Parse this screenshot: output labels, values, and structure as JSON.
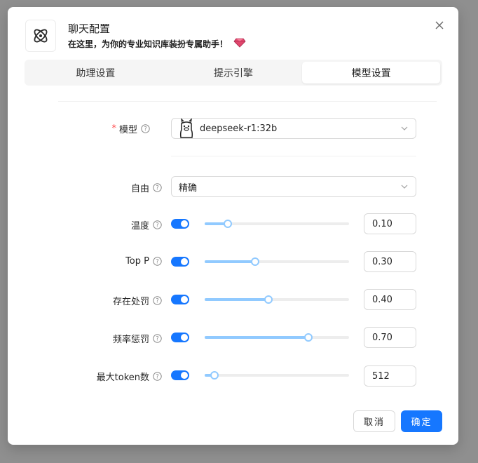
{
  "dialog": {
    "title": "聊天配置",
    "subtitle": "在这里，为你的专业知识库装扮专属助手！",
    "accent": "#1677ff"
  },
  "tabs": [
    {
      "label": "助理设置",
      "active": false
    },
    {
      "label": "提示引擎",
      "active": false
    },
    {
      "label": "模型设置",
      "active": true
    }
  ],
  "model": {
    "label": "模型",
    "required": true,
    "value": "deepseek-r1:32b"
  },
  "freedom": {
    "label": "自由",
    "value": "精确"
  },
  "params": [
    {
      "label": "温度",
      "enabled": true,
      "value": "0.10",
      "fraction": 0.1
    },
    {
      "label": "Top P",
      "enabled": true,
      "value": "0.30",
      "fraction": 0.3
    },
    {
      "label": "存在处罚",
      "enabled": true,
      "value": "0.40",
      "fraction": 0.4
    },
    {
      "label": "频率惩罚",
      "enabled": true,
      "value": "0.70",
      "fraction": 0.7
    },
    {
      "label": "最大token数",
      "enabled": true,
      "value": "512",
      "fraction": 0.0
    }
  ],
  "footer": {
    "cancel_label": "取消",
    "ok_label": "确定"
  }
}
